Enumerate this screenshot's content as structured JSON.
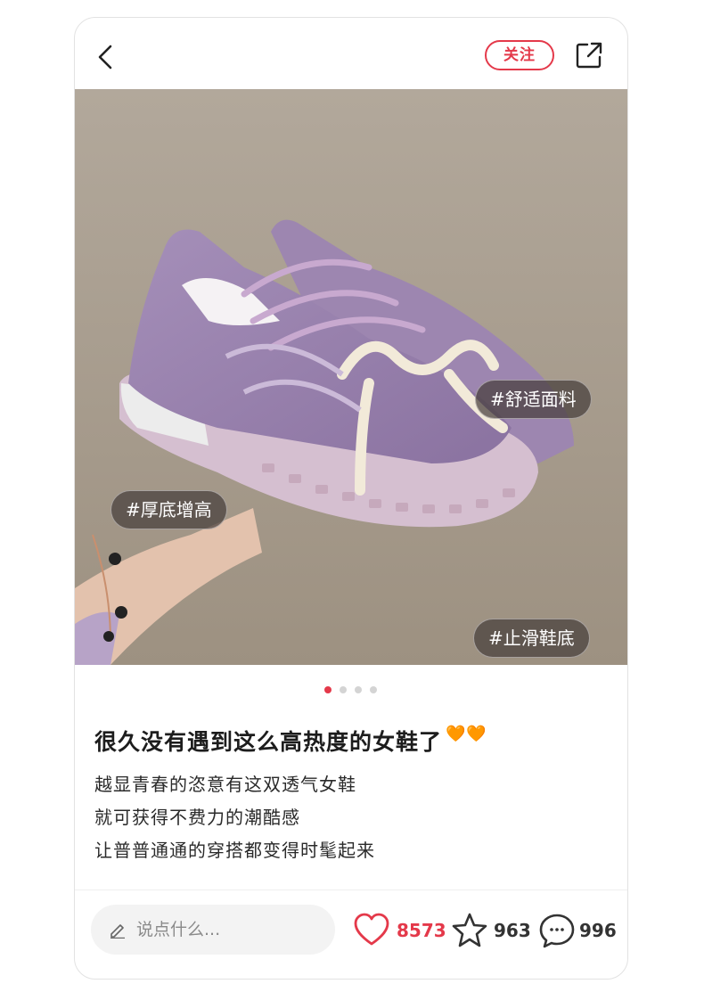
{
  "topbar": {
    "back_icon": "chevron-left-icon",
    "follow_label": "关注",
    "share_icon": "share-icon",
    "accent_color": "#e4394a"
  },
  "photo": {
    "alt": "purple chunky sneakers held in hand",
    "tags": [
      "#舒适面料",
      "#厚底增高",
      "#止滑鞋底"
    ],
    "pager": {
      "count": 4,
      "active": 1
    }
  },
  "post": {
    "title": "很久没有遇到这么高热度的女鞋了",
    "title_emoji": "🧡🧡",
    "body_lines": [
      "越显青春的恣意有这双透气女鞋",
      "就可获得不费力的潮酷感",
      "让普普通通的穿搭都变得时髦起来"
    ]
  },
  "bottom": {
    "comment_placeholder": "说点什么...",
    "likes": "8573",
    "stars": "963",
    "comments": "996"
  }
}
